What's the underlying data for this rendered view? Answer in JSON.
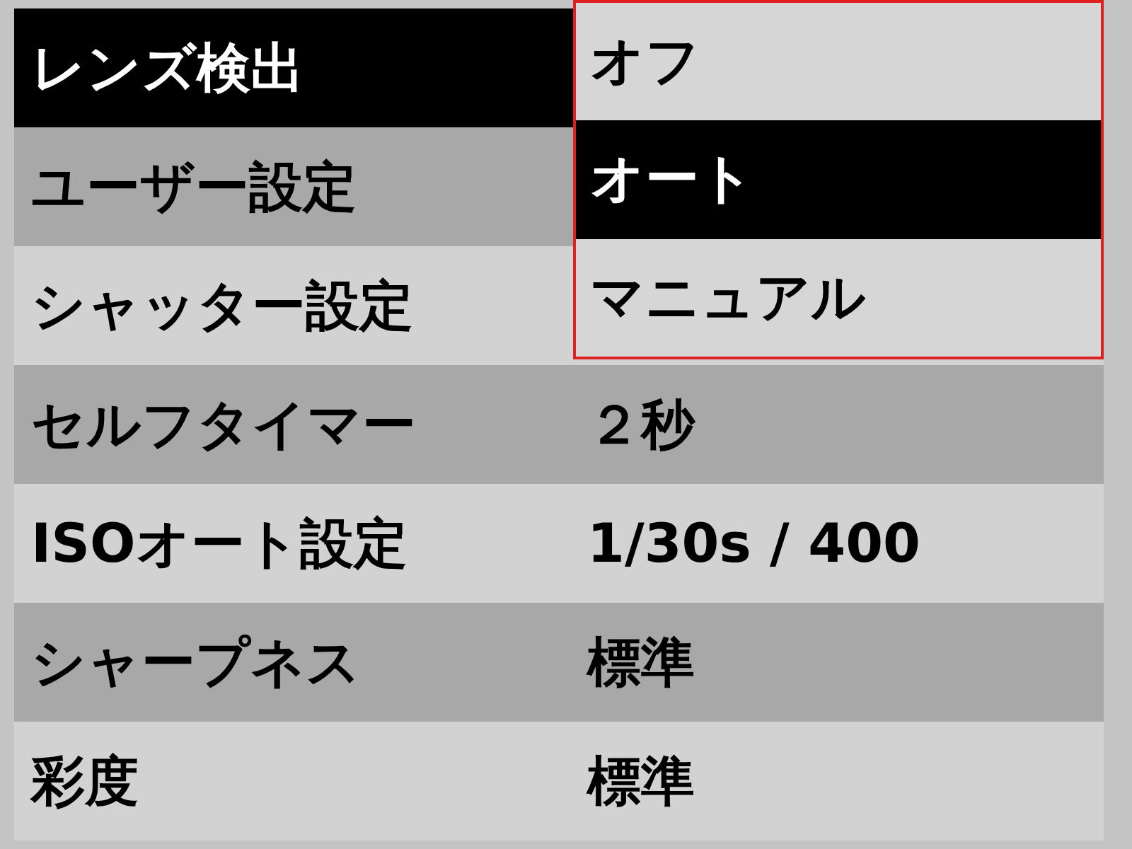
{
  "menu": {
    "items": [
      {
        "label": "レンズ検出",
        "selected": true
      },
      {
        "label": "ユーザー設定",
        "selected": false
      },
      {
        "label": "シャッター設定",
        "selected": false
      },
      {
        "label": "セルフタイマー",
        "value": "２秒",
        "selected": false
      },
      {
        "label": "ISOオート設定",
        "value": "1/30s / 400",
        "selected": false
      },
      {
        "label": "シャープネス",
        "value": "標準",
        "selected": false
      },
      {
        "label": "彩度",
        "value": "標準",
        "selected": false
      }
    ]
  },
  "dropdown": {
    "options": [
      {
        "label": "オフ",
        "selected": false
      },
      {
        "label": "オート",
        "selected": true
      },
      {
        "label": "マニュアル",
        "selected": false
      }
    ]
  }
}
